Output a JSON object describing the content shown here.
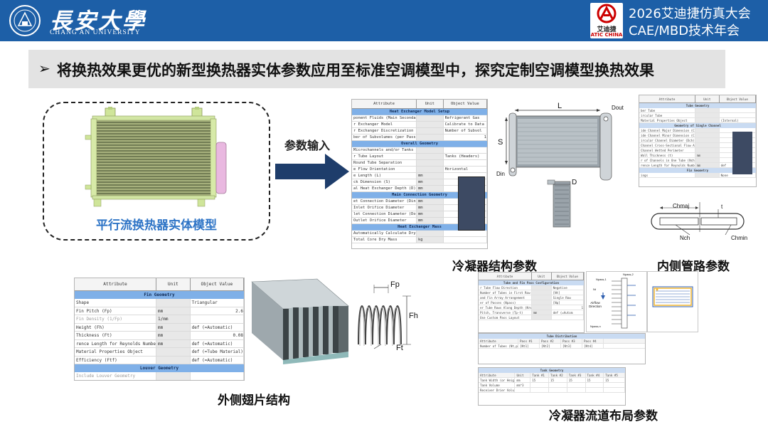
{
  "header": {
    "university_cn": "長安大學",
    "university_en": "CHANG'AN UNIVERSITY",
    "atic_logo_cn": "艾迪捷",
    "atic_logo_en": "ATIC CHINA",
    "conference_line1": "2026艾迪捷仿真大会",
    "conference_line2": "CAE/MBD技术年会",
    "colors": {
      "header_blue": "#1d5fa7",
      "banner_gray": "#e3e3e3",
      "caption_blue": "#2e74c6",
      "section_blue": "#7fb0e8",
      "arrow_navy": "#1e3d6b"
    }
  },
  "banner": {
    "bullet": "➢",
    "text": "将换热效果更优的新型换热器实体参数应用至标准空调模型中，探究定制空调模型换热效果"
  },
  "model": {
    "caption": "平行流换热器实体模型",
    "arrow_label": "参数输入"
  },
  "condenser_grid": {
    "headers": [
      "Attribute",
      "Unit",
      "Object Value"
    ],
    "rows": [
      {
        "type": "section",
        "label": "Heat Exchanger Model Setup"
      },
      {
        "attr": "ponent Fluids (Main Secondary)",
        "unit": "",
        "value": "Refrigerant Gas"
      },
      {
        "attr": "r Exchanger Model",
        "unit": "",
        "value": "Calibrate to Data"
      },
      {
        "attr": "r Exchanger Discretization",
        "unit": "",
        "value": "Number of Subvol"
      },
      {
        "attr": "ber of Subvolumes (per Pass)",
        "unit": "",
        "value": "1"
      },
      {
        "type": "section",
        "label": "Overall Geometry"
      },
      {
        "attr": "Microchannels and/or Tanks",
        "unit": "",
        "value": ""
      },
      {
        "attr": "r Tube Layout",
        "unit": "",
        "value": "Tanks (Headers)"
      },
      {
        "attr": "Round Tube Separation",
        "unit": "",
        "value": ""
      },
      {
        "attr": "e Flow Orientation",
        "unit": "",
        "value": "Horizontal"
      },
      {
        "attr": "e Length (L)",
        "unit": "mm",
        "value": ""
      },
      {
        "attr": "ck Dimension (S)",
        "unit": "mm",
        "value": ""
      },
      {
        "attr": "al Heat Exchanger Depth (D)",
        "unit": "mm",
        "value": ""
      },
      {
        "type": "section",
        "label": "Main Connection Geometry"
      },
      {
        "attr": "et Connection Diameter (Din)",
        "unit": "mm",
        "value": ""
      },
      {
        "attr": "Inlet Orifice Diameter",
        "unit": "mm",
        "value": ""
      },
      {
        "attr": "let Connection Diameter (Dout)",
        "unit": "mm",
        "value": ""
      },
      {
        "attr": "Outlet Orifice Diameter",
        "unit": "mm",
        "value": ""
      },
      {
        "type": "section",
        "label": "Heat Exchanger Mass"
      },
      {
        "attr": "Automatically Calculate Dry Mass",
        "unit": "",
        "value": ""
      },
      {
        "attr": "Total Core Dry Mass",
        "unit": "kg",
        "value": ""
      }
    ],
    "caption": "冷凝器结构参数"
  },
  "condenser_diagram": {
    "labels": {
      "L": "L",
      "S": "S",
      "Dout": "Dout",
      "Din": "Din",
      "D": "D"
    }
  },
  "tube_grid": {
    "headers": [
      "Attribute",
      "Unit",
      "Object Value"
    ],
    "rows": [
      {
        "type": "section",
        "label": "Tube Geometry"
      },
      {
        "attr": "ber Tube",
        "unit": "",
        "value": ""
      },
      {
        "attr": "ircular Tube",
        "unit": "",
        "value": ""
      },
      {
        "attr": "Material Properties Object",
        "unit": "",
        "value": "(Internal)"
      },
      {
        "type": "section",
        "label": "Geometry of Single Channel"
      },
      {
        "attr": "ide Channel Major Dimension (Chmaj)",
        "unit": "",
        "value": ""
      },
      {
        "attr": "ide Channel Minor Dimension (Chmin)",
        "unit": "",
        "value": ""
      },
      {
        "attr": "ircular Channel Diameter (Dch)",
        "unit": "",
        "value": ""
      },
      {
        "attr": "Channel Cross-Sectional Flow Area",
        "unit": "",
        "value": ""
      },
      {
        "attr": "Channel Wetted Perimeter",
        "unit": "",
        "value": ""
      },
      {
        "attr": "Wall Thickness (t)",
        "unit": "mm",
        "value": ""
      },
      {
        "attr": "r of Channels in One Tube (Nch)",
        "unit": "",
        "value": ""
      },
      {
        "attr": "rence Length for Reynolds Number",
        "unit": "mm",
        "value": "def"
      },
      {
        "type": "section",
        "label": "Fin Geometry"
      },
      {
        "attr": "ings",
        "unit": "",
        "value": "None"
      }
    ],
    "caption": "内侧管路参数"
  },
  "tube_diagram": {
    "labels": {
      "Chmaj": "Chmaj",
      "t": "t",
      "Nch": "Nch",
      "Chmin": "Chmin"
    }
  },
  "fin_grid": {
    "headers": [
      "Attribute",
      "Unit",
      "Object Value"
    ],
    "rows": [
      {
        "type": "section",
        "label": "Fin Geometry"
      },
      {
        "attr": "Shape",
        "unit": "",
        "value": "Triangular"
      },
      {
        "attr": "Fin Pitch (Fp)",
        "unit": "mm",
        "value": "2.6"
      },
      {
        "attr": "Fin Density (1/Fp)",
        "unit": "1/mm",
        "value": "",
        "dim": true
      },
      {
        "attr": "Height (Fh)",
        "unit": "mm",
        "value": "def (=Automatic)"
      },
      {
        "attr": "Thickness (Ft)",
        "unit": "mm",
        "value": "0.08"
      },
      {
        "attr": "rence Length for Reynolds Number",
        "unit": "mm",
        "value": "def (=Automatic)"
      },
      {
        "attr": "Material Properties Object",
        "unit": "",
        "value": "def (=Tube Material)"
      },
      {
        "attr": "Efficiency (Ftf)",
        "unit": "",
        "value": "def (=Automatic)"
      },
      {
        "type": "section",
        "label": "Louver Geometry"
      },
      {
        "attr": "Include Louver Geometry",
        "unit": "",
        "value": "",
        "dim": true
      }
    ],
    "caption": "外侧翅片结构",
    "diagram_labels": {
      "Fp": "Fp",
      "Fh": "Fh",
      "Ft": "Ft"
    }
  },
  "layout_grid": {
    "headers": [
      "Attribute",
      "Unit",
      "Object Value"
    ],
    "rows": [
      {
        "type": "section",
        "label": "Tube and Fin Pass Configuration"
      },
      {
        "attr": "r Tube Flow Direction",
        "unit": "",
        "value": "Negative"
      },
      {
        "attr": "Number of Tubes in First Row (Nt)",
        "unit": "",
        "value": "[Nt]"
      },
      {
        "attr": "and Fin Array Arrangement",
        "unit": "",
        "value": "Single Row"
      },
      {
        "attr": "er of Passes (Npass)",
        "unit": "",
        "value": "[Np]"
      },
      {
        "attr": "er Tube Rows Along Depth (Nrw)",
        "unit": "",
        "value": "1"
      },
      {
        "attr": "Pitch, Transverse (Tp-t)",
        "unit": "mm",
        "value": "def (=Autom"
      },
      {
        "attr": "Use Custom Pass Layout",
        "unit": "",
        "value": ""
      }
    ],
    "dist_section": "Tube Distribution",
    "dist_headers": [
      "Attribute",
      "Pass #1",
      "Pass #2",
      "Pass #3",
      "Pass #4"
    ],
    "dist_row": {
      "attr": "Number of Tubes (Nt,pass)",
      "vals": [
        "[Nt1]",
        "[Nt2]",
        "[Nt3]",
        "[Nt4]"
      ]
    },
    "tank_section": "Tank Geometry",
    "tank_headers": [
      "Attribute",
      "Unit",
      "Tank #1",
      "Tank #2",
      "Tank #3",
      "Tank #4",
      "Tank #5"
    ],
    "tank_rows": [
      {
        "attr": "Tank Width (or Height)",
        "unit": "mm",
        "vals": [
          "15",
          "15",
          "15",
          "15",
          "15"
        ]
      },
      {
        "attr": "Tank Volume",
        "unit": "mm^3",
        "vals": [
          "",
          "",
          "",
          "",
          ""
        ]
      },
      {
        "attr": "Receiver Drier Volume",
        "unit": "",
        "vals": [
          "",
          "",
          "",
          "",
          ""
        ]
      }
    ],
    "flow_labels": {
      "N_pass1": "Npass,1",
      "N_pass2": "Npass,2",
      "Nt": "Nt",
      "airflow": "Airflow Direction",
      "Npass_n": "Npass,n",
      "Npass1": "Npass,1",
      "Npass2": "Npass,2"
    },
    "caption": "冷凝器流道布局参数"
  }
}
